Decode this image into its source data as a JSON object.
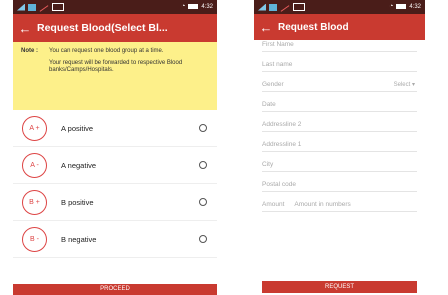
{
  "screen1": {
    "title": "Request Blood(Select Bl...",
    "note_label": "Note :",
    "note_lines": [
      "You can request one blood group at a time.",
      "Your request will be forwarded to respective Blood banks/Camps/Hospitals."
    ],
    "groups": [
      {
        "code": "A +",
        "name": "A positive"
      },
      {
        "code": "A -",
        "name": "A negative"
      },
      {
        "code": "B +",
        "name": "B positive"
      },
      {
        "code": "B -",
        "name": "B negative"
      }
    ],
    "proceed_label": "PROCEED"
  },
  "screen2": {
    "title": "Request Blood",
    "fields": {
      "first_name": "First Name",
      "last_name": "Last name",
      "gender": "Gender",
      "gender_select": "Select",
      "date": "Date",
      "address2": "Addressline 2",
      "address1": "Addressline 1",
      "city": "City",
      "postal": "Postal code",
      "amount": "Amount",
      "amount_placeholder": "Amount in numbers"
    },
    "request_label": "REQUEST"
  },
  "status": {
    "time": "4:32"
  },
  "colors": {
    "primary": "#c93a30",
    "statusbar": "#4a1d19",
    "note_bg": "#fdf08a"
  }
}
